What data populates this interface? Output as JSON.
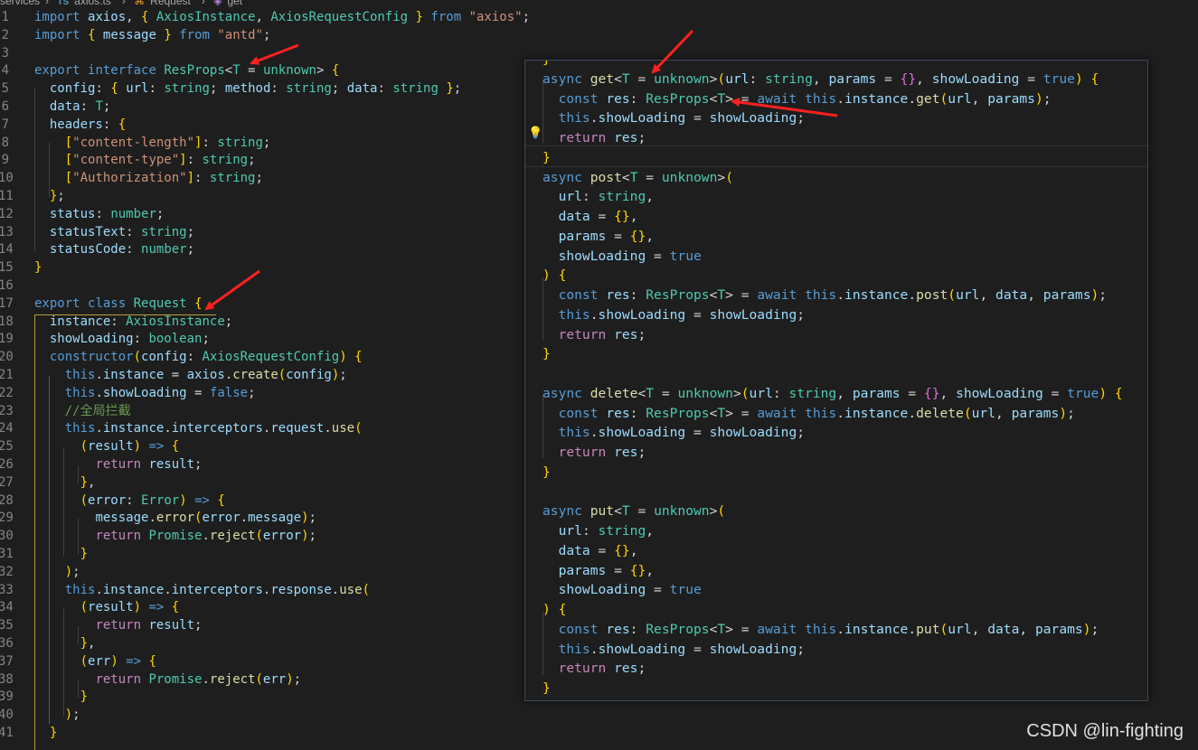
{
  "breadcrumb": {
    "folder": "services",
    "file": "axios.ts",
    "class": "Request",
    "method": "get"
  },
  "editor": {
    "lines": [
      {
        "n": "1",
        "t": "import axios, { AxiosInstance, AxiosRequestConfig } from \"axios\";"
      },
      {
        "n": "2",
        "t": "import { message } from \"antd\";"
      },
      {
        "n": "3",
        "t": ""
      },
      {
        "n": "4",
        "t": "export interface ResProps<T = unknown> {"
      },
      {
        "n": "5",
        "t": "  config: { url: string; method: string; data: string };"
      },
      {
        "n": "6",
        "t": "  data: T;"
      },
      {
        "n": "7",
        "t": "  headers: {"
      },
      {
        "n": "8",
        "t": "    [\"content-length\"]: string;"
      },
      {
        "n": "9",
        "t": "    [\"content-type\"]: string;"
      },
      {
        "n": "10",
        "t": "    [\"Authorization\"]: string;"
      },
      {
        "n": "11",
        "t": "  };"
      },
      {
        "n": "12",
        "t": "  status: number;"
      },
      {
        "n": "13",
        "t": "  statusText: string;"
      },
      {
        "n": "14",
        "t": "  statusCode: number;"
      },
      {
        "n": "15",
        "t": "}"
      },
      {
        "n": "16",
        "t": ""
      },
      {
        "n": "17",
        "t": "export class Request {"
      },
      {
        "n": "18",
        "t": "  instance: AxiosInstance;"
      },
      {
        "n": "19",
        "t": "  showLoading: boolean;"
      },
      {
        "n": "20",
        "t": "  constructor(config: AxiosRequestConfig) {"
      },
      {
        "n": "21",
        "t": "    this.instance = axios.create(config);"
      },
      {
        "n": "22",
        "t": "    this.showLoading = false;"
      },
      {
        "n": "23",
        "t": "    //全局拦截"
      },
      {
        "n": "24",
        "t": "    this.instance.interceptors.request.use("
      },
      {
        "n": "25",
        "t": "      (result) => {"
      },
      {
        "n": "26",
        "t": "        return result;"
      },
      {
        "n": "27",
        "t": "      },"
      },
      {
        "n": "28",
        "t": "      (error: Error) => {"
      },
      {
        "n": "29",
        "t": "        message.error(error.message);"
      },
      {
        "n": "30",
        "t": "        return Promise.reject(error);"
      },
      {
        "n": "31",
        "t": "      }"
      },
      {
        "n": "32",
        "t": "    );"
      },
      {
        "n": "33",
        "t": "    this.instance.interceptors.response.use("
      },
      {
        "n": "34",
        "t": "      (result) => {"
      },
      {
        "n": "35",
        "t": "        return result;"
      },
      {
        "n": "36",
        "t": "      },"
      },
      {
        "n": "37",
        "t": "      (err) => {"
      },
      {
        "n": "38",
        "t": "        return Promise.reject(err);"
      },
      {
        "n": "39",
        "t": "      }"
      },
      {
        "n": "40",
        "t": "    );"
      },
      {
        "n": "41",
        "t": "  }"
      }
    ]
  },
  "panel": {
    "lines": [
      "}",
      "async get<T = unknown>(url: string, params = {}, showLoading = true) {",
      "  const res: ResProps<T> = await this.instance.get(url, params);",
      "  this.showLoading = showLoading;",
      "  return res;",
      "}",
      "async post<T = unknown>(",
      "  url: string,",
      "  data = {},",
      "  params = {},",
      "  showLoading = true",
      ") {",
      "  const res: ResProps<T> = await this.instance.post(url, data, params);",
      "  this.showLoading = showLoading;",
      "  return res;",
      "}",
      "",
      "async delete<T = unknown>(url: string, params = {}, showLoading = true) {",
      "  const res: ResProps<T> = await this.instance.delete(url, params);",
      "  this.showLoading = showLoading;",
      "  return res;",
      "}",
      "",
      "async put<T = unknown>(",
      "  url: string,",
      "  data = {},",
      "  params = {},",
      "  showLoading = true",
      ") {",
      "  const res: ResProps<T> = await this.instance.put(url, data, params);",
      "  this.showLoading = showLoading;",
      "  return res;",
      "}"
    ]
  },
  "watermark": "CSDN @lin-fighting",
  "colors": {
    "background": "#1e1e1e",
    "keyword": "#569cd6",
    "control": "#c586c0",
    "type": "#4ec9b0",
    "string": "#ce9178",
    "function": "#dcdcaa",
    "variable": "#9cdcfe",
    "comment": "#6a9955",
    "arrow": "#ff2020"
  },
  "icons": [
    "ts-file-icon",
    "class-icon",
    "method-icon",
    "lightbulb-icon",
    "red-arrow-annotation"
  ]
}
